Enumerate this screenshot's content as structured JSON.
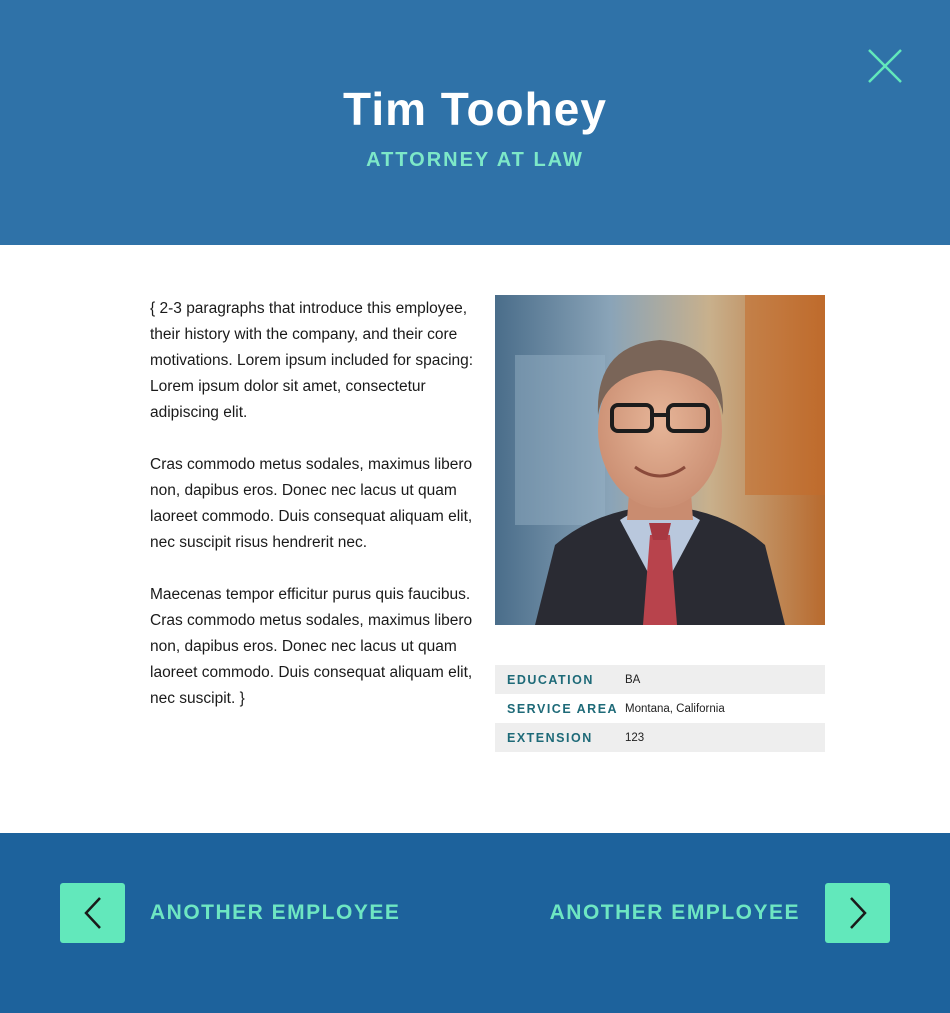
{
  "header": {
    "name": "Tim Toohey",
    "title": "ATTORNEY AT LAW",
    "close_icon": "close-icon"
  },
  "bio": {
    "paragraphs": [
      "{ 2-3 paragraphs that introduce this employee, their history with the company, and their core motivations. Lorem ipsum included for spacing: Lorem ipsum dolor sit amet, consectetur adipiscing elit.",
      "Cras commodo metus sodales, maximus libero non, dapibus eros. Donec nec lacus ut quam laoreet commodo. Duis consequat aliquam elit, nec suscipit risus hendrerit nec.",
      "Maecenas tempor efficitur purus quis faucibus. Cras commodo metus sodales, maximus libero non, dapibus eros. Donec nec lacus ut quam laoreet commodo. Duis consequat aliquam elit, nec suscipit. }"
    ]
  },
  "photo": {
    "icon": "portrait-photo"
  },
  "details": [
    {
      "label": "EDUCATION",
      "value": "BA"
    },
    {
      "label": "SERVICE AREA",
      "value": "Montana, California"
    },
    {
      "label": "EXTENSION",
      "value": "123"
    }
  ],
  "footer": {
    "prev_label": "ANOTHER EMPLOYEE",
    "next_label": "ANOTHER EMPLOYEE",
    "prev_icon": "chevron-left-icon",
    "next_icon": "chevron-right-icon"
  },
  "colors": {
    "header_bg": "#2f72a8",
    "footer_bg": "#1d629c",
    "accent": "#62e8bb",
    "label_teal": "#1e6a78"
  }
}
